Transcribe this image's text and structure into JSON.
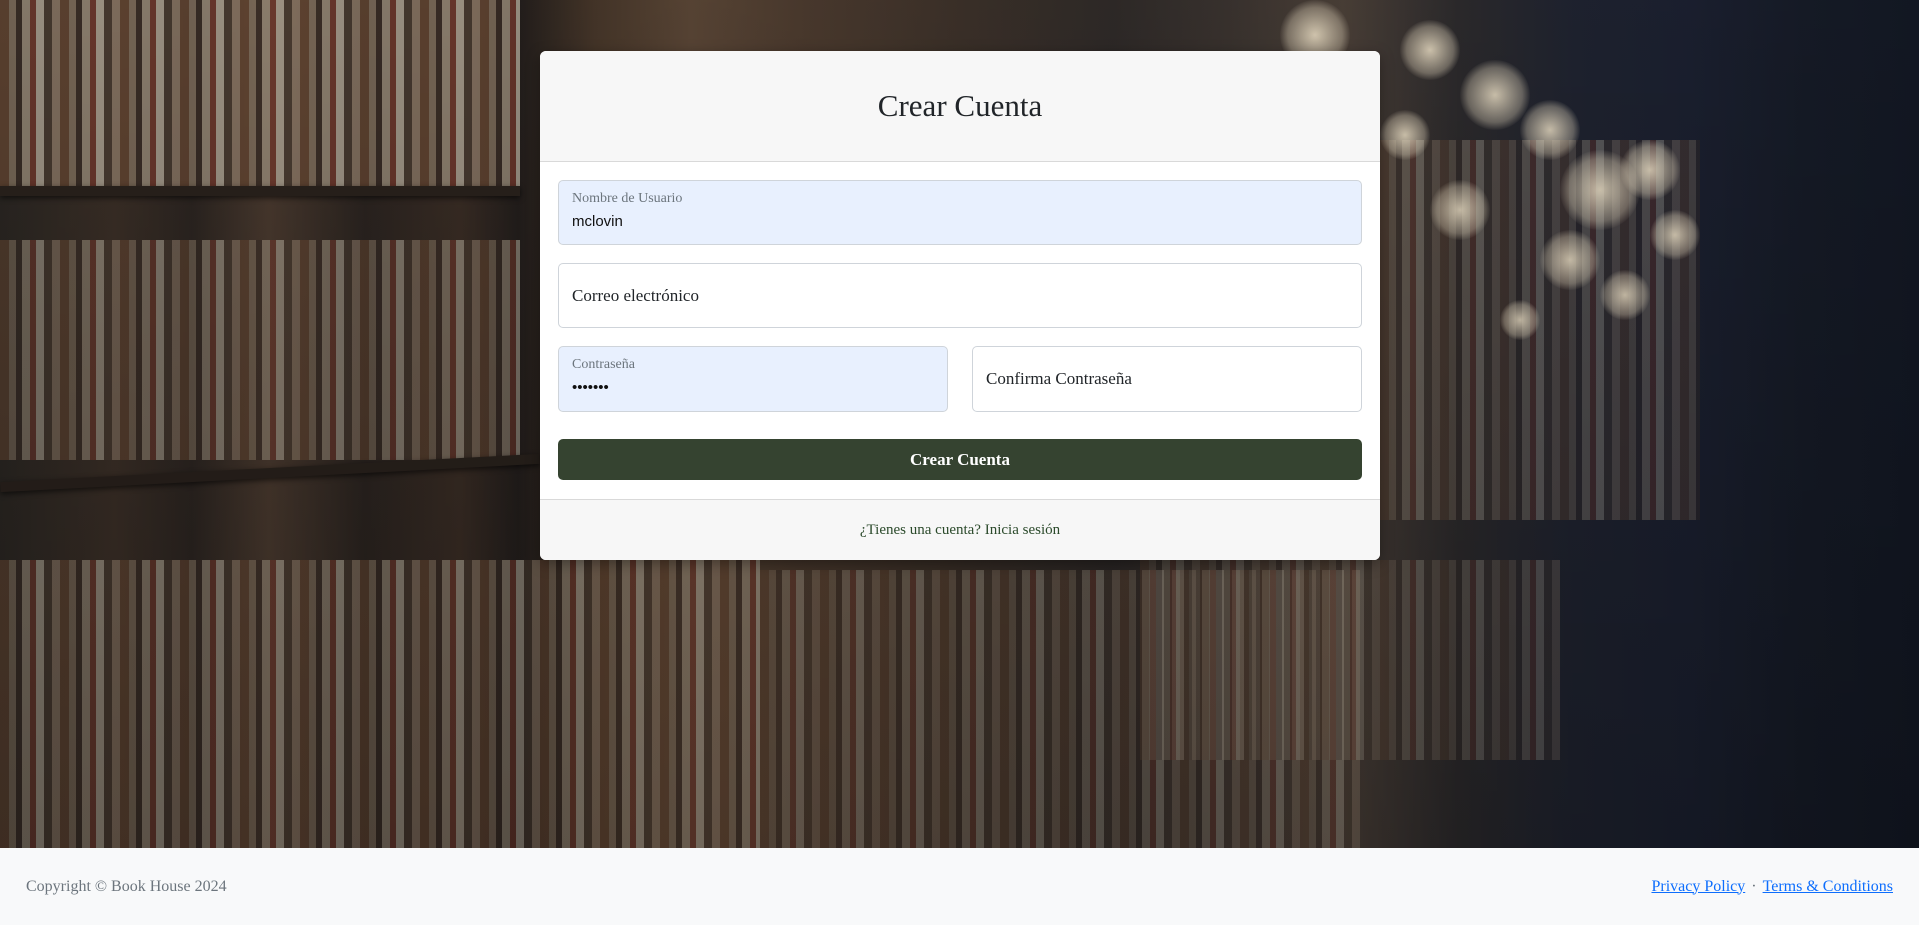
{
  "form": {
    "title": "Crear Cuenta",
    "username": {
      "label": "Nombre de Usuario",
      "value": "mclovin"
    },
    "email": {
      "placeholder": "Correo electrónico"
    },
    "password": {
      "label": "Contraseña",
      "value": "•••••••"
    },
    "confirm_password": {
      "placeholder": "Confirma Contraseña"
    },
    "submit_label": "Crear Cuenta",
    "login_link": "¿Tienes una cuenta? Inicia sesión"
  },
  "footer": {
    "copyright": "Copyright © Book House 2024",
    "privacy": "Privacy Policy",
    "separator": "·",
    "terms": "Terms & Conditions"
  },
  "colors": {
    "primary_button": "#354330",
    "autofill_bg": "#e8f0fe",
    "link": "#0d6efd"
  }
}
